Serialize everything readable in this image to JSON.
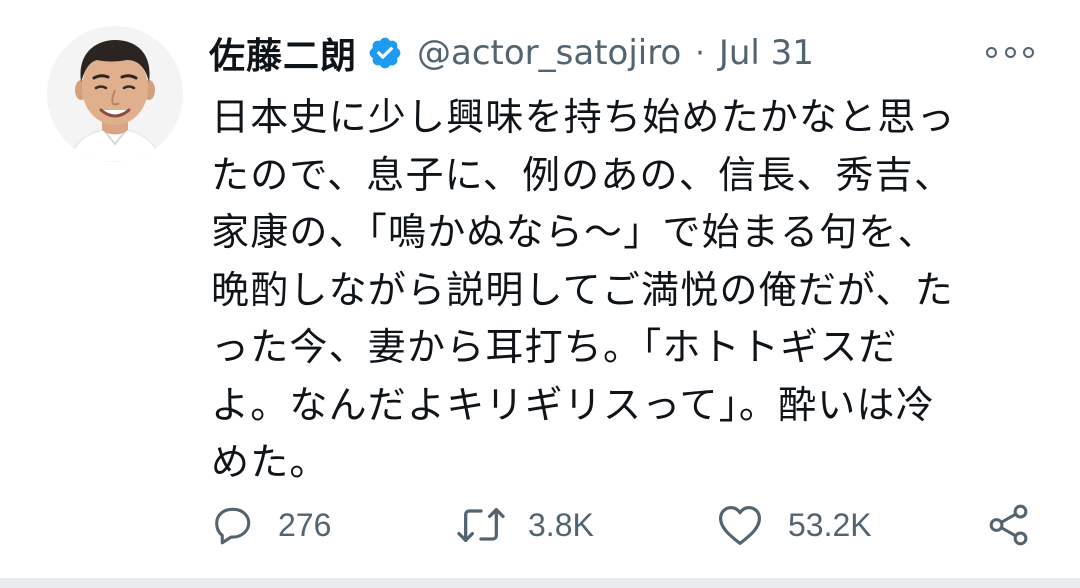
{
  "tweet": {
    "display_name": "佐藤二朗",
    "handle": "@actor_satojiro",
    "separator": "·",
    "date": "Jul 31",
    "body_lines": [
      "日本史に少し興味を持ち始めたかなと思っ",
      "たので、息子に、例のあの、信長、秀吉、",
      "家康の、「鳴かぬなら〜」で始まる句を、",
      "晩酌しながら説明してご満悦の俺だが、た",
      "った今、妻から耳打ち。「ホトトギスだ",
      "よ。なんだよキリギリスって」。酔いは冷",
      "めた。"
    ],
    "verified": true
  },
  "actions": {
    "reply_count": "276",
    "retweet_count": "3.8K",
    "like_count": "53.2K"
  },
  "icons": {
    "reply": "speech-bubble-icon",
    "retweet": "retweet-arrows-icon",
    "like": "heart-icon",
    "share": "share-nodes-icon",
    "more": "more-options-icon",
    "verified": "verified-badge-icon"
  },
  "colors": {
    "verified_blue": "#1d9bf0",
    "secondary_text": "#536471",
    "primary_text": "#0f1419"
  }
}
